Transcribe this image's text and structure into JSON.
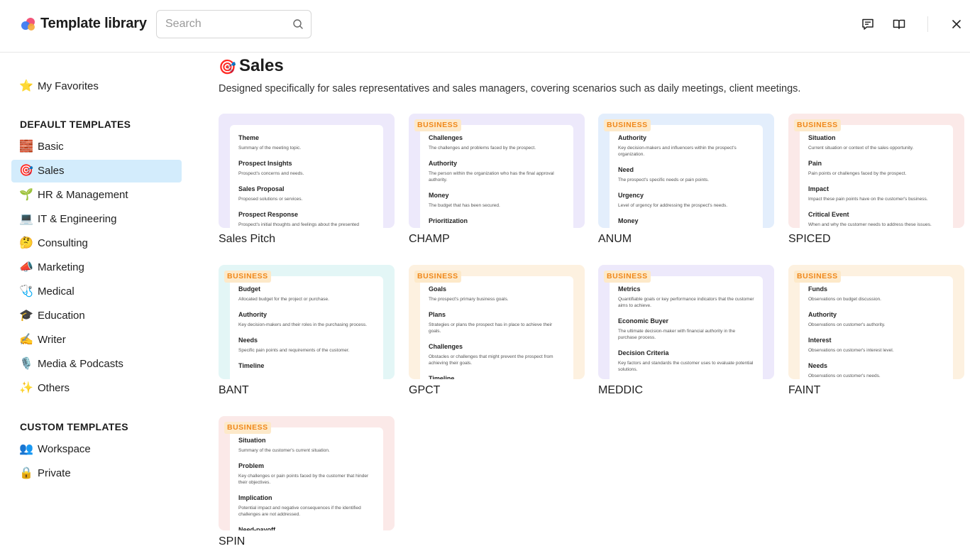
{
  "header": {
    "title": "Template library",
    "search_placeholder": "Search",
    "search_value": "",
    "icons": [
      "feedback-icon",
      "book-icon",
      "close-icon"
    ]
  },
  "sidebar": {
    "favorites": {
      "emoji": "⭐",
      "label": "My Favorites"
    },
    "default_heading": "DEFAULT TEMPLATES",
    "default_items": [
      {
        "emoji": "🧱",
        "label": "Basic"
      },
      {
        "emoji": "🎯",
        "label": "Sales"
      },
      {
        "emoji": "🌱",
        "label": "HR & Management"
      },
      {
        "emoji": "💻",
        "label": "IT & Engineering"
      },
      {
        "emoji": "🤔",
        "label": "Consulting"
      },
      {
        "emoji": "📣",
        "label": "Marketing"
      },
      {
        "emoji": "🩺",
        "label": "Medical"
      },
      {
        "emoji": "🎓",
        "label": "Education"
      },
      {
        "emoji": "✍️",
        "label": "Writer"
      },
      {
        "emoji": "🎙️",
        "label": "Media & Podcasts"
      },
      {
        "emoji": "✨",
        "label": "Others"
      }
    ],
    "custom_heading": "CUSTOM TEMPLATES",
    "custom_items": [
      {
        "emoji": "👥",
        "label": "Workspace"
      },
      {
        "emoji": "🔒",
        "label": "Private"
      }
    ],
    "active_item": "Sales"
  },
  "main": {
    "category_emoji": "🎯",
    "category_title": "Sales",
    "category_description": "Designed specifically for sales representatives and sales managers, covering scenarios such as daily meetings, client meetings.",
    "templates": [
      {
        "name": "Sales Pitch",
        "badge": "",
        "bg": "#ede9fb",
        "sections": [
          {
            "title": "Theme",
            "desc": "Summary of the meeting topic."
          },
          {
            "title": "Prospect Insights",
            "desc": "Prospect's concerns and needs."
          },
          {
            "title": "Sales Proposal",
            "desc": "Proposed solutions or services."
          },
          {
            "title": "Prospect Response",
            "desc": "Prospect's initial thoughts and feelings about the presented"
          }
        ]
      },
      {
        "name": "CHAMP",
        "badge": "BUSINESS",
        "bg": "#ede9fb",
        "sections": [
          {
            "title": "Challenges",
            "desc": "The challenges and problems faced by the prospect."
          },
          {
            "title": "Authority",
            "desc": "The person within the organization who has the final approval authority."
          },
          {
            "title": "Money",
            "desc": "The budget that has been secured."
          },
          {
            "title": "Prioritization",
            "desc": ""
          }
        ]
      },
      {
        "name": "ANUM",
        "badge": "BUSINESS",
        "bg": "#e3eefc",
        "sections": [
          {
            "title": "Authority",
            "desc": "Key decision-makers and influencers within the prospect's organization."
          },
          {
            "title": "Need",
            "desc": "The prospect's specific needs or pain points."
          },
          {
            "title": "Urgency",
            "desc": "Level of urgency for addressing the prospect's needs."
          },
          {
            "title": "Money",
            "desc": ""
          }
        ]
      },
      {
        "name": "SPICED",
        "badge": "BUSINESS",
        "bg": "#fbe9e8",
        "sections": [
          {
            "title": "Situation",
            "desc": "Current situation or context of the sales opportunity."
          },
          {
            "title": "Pain",
            "desc": "Pain points or challenges faced by the prospect."
          },
          {
            "title": "Impact",
            "desc": "Impact these pain points have on the customer's business."
          },
          {
            "title": "Critical Event",
            "desc": "When and why the customer needs to address these issues."
          }
        ]
      },
      {
        "name": "BANT",
        "badge": "BUSINESS",
        "bg": "#e3f6f6",
        "sections": [
          {
            "title": "Budget",
            "desc": "Allocated budget for the project or purchase."
          },
          {
            "title": "Authority",
            "desc": "Key decision-makers and their roles in the purchasing process."
          },
          {
            "title": "Needs",
            "desc": "Specific pain points and requirements of the customer."
          },
          {
            "title": "Timeline",
            "desc": ""
          }
        ]
      },
      {
        "name": "GPCT",
        "badge": "BUSINESS",
        "bg": "#fdf1e0",
        "sections": [
          {
            "title": "Goals",
            "desc": "The prospect's primary business goals."
          },
          {
            "title": "Plans",
            "desc": "Strategies or plans the prospect has in place to achieve their goals."
          },
          {
            "title": "Challenges",
            "desc": "Obstacles or challenges that might prevent the prospect from achieving their goals."
          },
          {
            "title": "Timeline",
            "desc": ""
          }
        ]
      },
      {
        "name": "MEDDIC",
        "badge": "BUSINESS",
        "bg": "#ede9fb",
        "sections": [
          {
            "title": "Metrics",
            "desc": "Quantifiable goals or key performance indicators that the customer aims to achieve."
          },
          {
            "title": "Economic Buyer",
            "desc": "The ultimate decision-maker with financial authority in the purchase process."
          },
          {
            "title": "Decision Criteria",
            "desc": "Key factors and standards the customer uses to evaluate potential solutions."
          }
        ]
      },
      {
        "name": "FAINT",
        "badge": "BUSINESS",
        "bg": "#fdf1e0",
        "sections": [
          {
            "title": "Funds",
            "desc": "Observations on budget discussion."
          },
          {
            "title": "Authority",
            "desc": "Observations on customer's authority."
          },
          {
            "title": "Interest",
            "desc": "Observations on customer's interest level."
          },
          {
            "title": "Needs",
            "desc": "Observations on customer's needs."
          }
        ]
      },
      {
        "name": "SPIN",
        "badge": "BUSINESS",
        "bg": "#fbe9e8",
        "sections": [
          {
            "title": "Situation",
            "desc": "Summary of the customer's current situation."
          },
          {
            "title": "Problem",
            "desc": "Key challenges or pain points faced by the customer that hinder their objectives."
          },
          {
            "title": "Implication",
            "desc": "Potential impact and negative consequences if the identified challenges are not addressed."
          },
          {
            "title": "Need-payoff",
            "desc": ""
          }
        ]
      }
    ]
  }
}
